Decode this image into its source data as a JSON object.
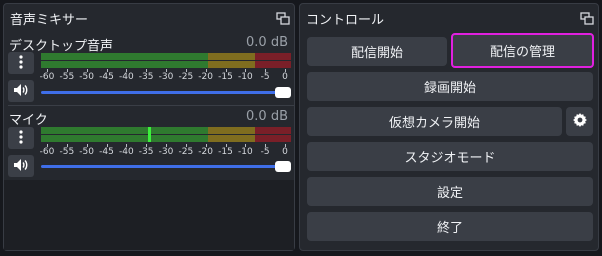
{
  "mixer": {
    "title": "音声ミキサー",
    "channels": [
      {
        "name": "デスクトップ音声",
        "level": "0.0 dB",
        "volume_fraction": 1.0,
        "active_peak_db": null
      },
      {
        "name": "マイク",
        "level": "0.0 dB",
        "volume_fraction": 1.0,
        "active_peak_db": -35
      }
    ],
    "tick_labels": [
      "-60",
      "-55",
      "-50",
      "-45",
      "-40",
      "-35",
      "-30",
      "-25",
      "-20",
      "-15",
      "-10",
      "-5",
      "0"
    ]
  },
  "controls": {
    "title": "コントロール",
    "start_streaming": "配信開始",
    "manage_broadcast": "配信の管理",
    "start_recording": "録画開始",
    "start_virtual_camera": "仮想カメラ開始",
    "studio_mode": "スタジオモード",
    "settings": "設定",
    "exit": "終了"
  },
  "colors": {
    "meter_green": "#2f7a2f",
    "meter_yellow": "#7f6d1f",
    "meter_red": "#7a1f28",
    "fader_blue": "#3f6ee8",
    "highlight": "#e020e0",
    "active_peak": "#3cf03c"
  },
  "icons": {
    "undock": "undock-icon",
    "menu": "vertical-dots-icon",
    "speaker": "speaker-icon",
    "gear": "gear-icon"
  }
}
